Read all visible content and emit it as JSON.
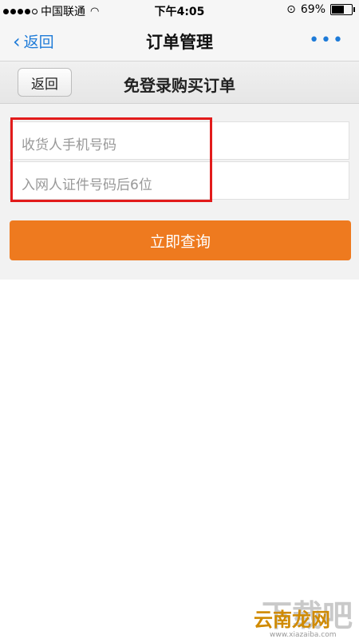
{
  "status_bar": {
    "carrier": "中国联通",
    "time": "下午4:05",
    "battery_text": "69%",
    "battery_level": 0.69
  },
  "nav": {
    "back_label": "返回",
    "title": "订单管理",
    "more_label": "•••"
  },
  "page": {
    "back_label": "返回",
    "title": "免登录购买订单"
  },
  "form": {
    "phone_placeholder": "收货人手机号码",
    "id_placeholder": "入网人证件号码后6位",
    "submit_label": "立即查询"
  },
  "watermark": {
    "big": "下载吧",
    "small": "云南龙网",
    "url": "www.xiazaiba.com"
  }
}
